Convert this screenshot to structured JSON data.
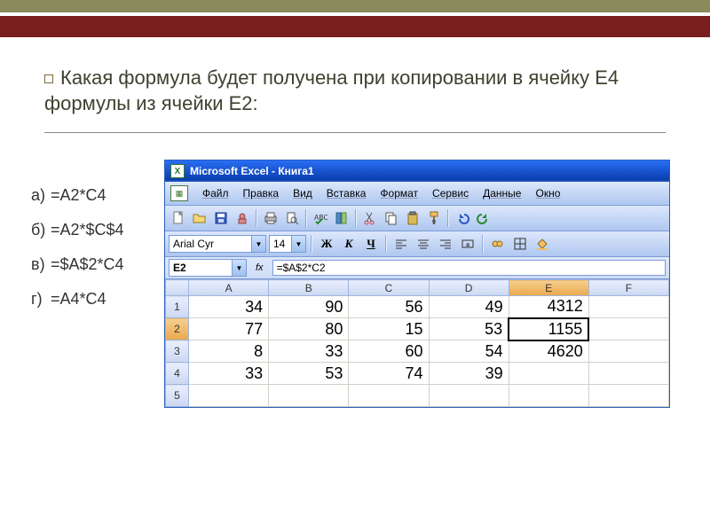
{
  "question": "Какая формула будет получена при копировании в ячейку E4 формулы из ячейки E2:",
  "answers": {
    "a": {
      "label": "а)",
      "text": "=A2*C4"
    },
    "b": {
      "label": "б)",
      "text": "=A2*$C$4"
    },
    "c": {
      "label": "в)",
      "text": "=$A$2*C4"
    },
    "d": {
      "label": "г)",
      "text": "=A4*C4"
    }
  },
  "window": {
    "title": "Microsoft Excel - Книга1"
  },
  "menus": {
    "file": "Файл",
    "edit": "Правка",
    "view": "Вид",
    "insert": "Вставка",
    "format": "Формат",
    "service": "Сервис",
    "data": "Данные",
    "window": "Окно"
  },
  "font": {
    "name": "Arial Cyr",
    "size": "14"
  },
  "format_labels": {
    "bold": "Ж",
    "italic": "К",
    "underline": "Ч"
  },
  "namebox": "E2",
  "fx_label": "fx",
  "formula": "=$A$2*C2",
  "columns": [
    "A",
    "B",
    "C",
    "D",
    "E",
    "F"
  ],
  "rows": [
    "1",
    "2",
    "3",
    "4",
    "5"
  ],
  "grid": [
    [
      "34",
      "90",
      "56",
      "49",
      "4312",
      ""
    ],
    [
      "77",
      "80",
      "15",
      "53",
      "1155",
      ""
    ],
    [
      "8",
      "33",
      "60",
      "54",
      "4620",
      ""
    ],
    [
      "33",
      "53",
      "74",
      "39",
      "",
      ""
    ],
    [
      "",
      "",
      "",
      "",
      "",
      ""
    ]
  ],
  "active": {
    "row": 1,
    "col": 4
  }
}
